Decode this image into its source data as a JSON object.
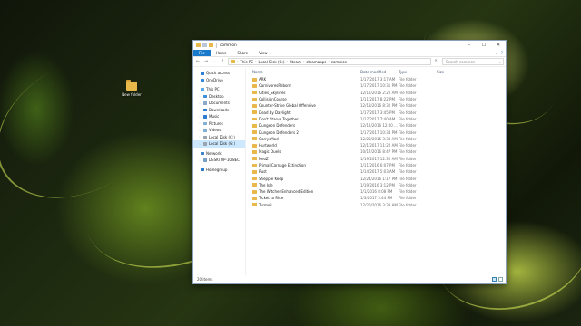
{
  "desktop": {
    "icon_label": "New folder"
  },
  "window": {
    "title": "common",
    "tabs": [
      "File",
      "Home",
      "Share",
      "View"
    ],
    "controls": {
      "minimize": "–",
      "maximize": "☐",
      "close": "✕"
    },
    "address": [
      "This PC",
      "Local Disk (G:)",
      "Steam",
      "steamapps",
      "common"
    ],
    "search_placeholder": "Search common",
    "nav": [
      {
        "label": "Quick access",
        "icon": "#2c7fd4",
        "indent": 0,
        "expander": false
      },
      {
        "label": "OneDrive",
        "icon": "#2f88e0",
        "indent": 0,
        "expander": false
      },
      {
        "label": "This PC",
        "icon": "#5aa7e8",
        "indent": 0,
        "expander": false
      },
      {
        "label": "Desktop",
        "icon": "#3f8fd6",
        "indent": 1,
        "expander": true
      },
      {
        "label": "Documents",
        "icon": "#8aa8c8",
        "indent": 1,
        "expander": true
      },
      {
        "label": "Downloads",
        "icon": "#2e7bd0",
        "indent": 1,
        "expander": true
      },
      {
        "label": "Music",
        "icon": "#2e7bd0",
        "indent": 1,
        "expander": true
      },
      {
        "label": "Pictures",
        "icon": "#7fb0d8",
        "indent": 1,
        "expander": true
      },
      {
        "label": "Videos",
        "icon": "#7fb0d8",
        "indent": 1,
        "expander": true
      },
      {
        "label": "Local Disk (C:)",
        "icon": "#9aa5b0",
        "indent": 1,
        "expander": true
      },
      {
        "label": "Local Disk (G:)",
        "icon": "#9aa5b0",
        "indent": 1,
        "expander": true,
        "selected": true
      },
      {
        "label": "Network",
        "icon": "#3d85c6",
        "indent": 0,
        "expander": false
      },
      {
        "label": "DESKTOP-10I8EC",
        "icon": "#7aa0c4",
        "indent": 1,
        "expander": true
      },
      {
        "label": "Homegroup",
        "icon": "#2f79c9",
        "indent": 0,
        "expander": false
      }
    ],
    "columns": {
      "name": "Name",
      "date": "Date modified",
      "type": "Type",
      "size": "Size"
    },
    "files": [
      {
        "name": "ARK",
        "date": "1/17/2017 3:17 AM",
        "type": "File folder"
      },
      {
        "name": "CarnivoresReborn",
        "date": "1/17/2017 10:31 PM",
        "type": "File folder"
      },
      {
        "name": "Cities_Skylines",
        "date": "12/12/2016 2:20 AM",
        "type": "File folder"
      },
      {
        "name": "CollisionCourse",
        "date": "1/11/2017 8:22 PM",
        "type": "File folder"
      },
      {
        "name": "Counter-Strike Global Offensive",
        "date": "12/18/2016 8:32 PM",
        "type": "File folder"
      },
      {
        "name": "Dead by Daylight",
        "date": "1/17/2017 3:45 PM",
        "type": "File folder"
      },
      {
        "name": "Don't Starve Together",
        "date": "1/17/2017 7:40 AM",
        "type": "File folder"
      },
      {
        "name": "Dungeon Defenders",
        "date": "12/12/2016 12:00 ...",
        "type": "File folder"
      },
      {
        "name": "Dungeon Defenders 2",
        "date": "1/17/2017 10:34 PM",
        "type": "File folder"
      },
      {
        "name": "GarrysMod",
        "date": "12/20/2016 3:33 AM",
        "type": "File folder"
      },
      {
        "name": "Hurtworld",
        "date": "12/1/2017 11:20 AM",
        "type": "File folder"
      },
      {
        "name": "Magic Duels",
        "date": "10/17/2016 8:47 PM",
        "type": "File folder"
      },
      {
        "name": "NeoZ",
        "date": "1/19/2017 12:32 AM",
        "type": "File folder"
      },
      {
        "name": "Primal Carnage Extinction",
        "date": "1/11/2016 6:07 PM",
        "type": "File folder"
      },
      {
        "name": "Rust",
        "date": "1/14/2017 5:03 AM",
        "type": "File folder"
      },
      {
        "name": "Sheppie Keep",
        "date": "12/24/2016 1:17 PM",
        "type": "File folder"
      },
      {
        "name": "The Isle",
        "date": "1/19/2016 3:12 PM",
        "type": "File folder"
      },
      {
        "name": "The Witcher Enhanced Edition",
        "date": "1/1/2016 8:08 PM",
        "type": "File folder"
      },
      {
        "name": "Ticket to Ride",
        "date": "1/3/2017 3:44 PM",
        "type": "File folder"
      },
      {
        "name": "Turmoil",
        "date": "12/20/2016 3:33 AM",
        "type": "File folder"
      }
    ],
    "status": "20 items"
  }
}
